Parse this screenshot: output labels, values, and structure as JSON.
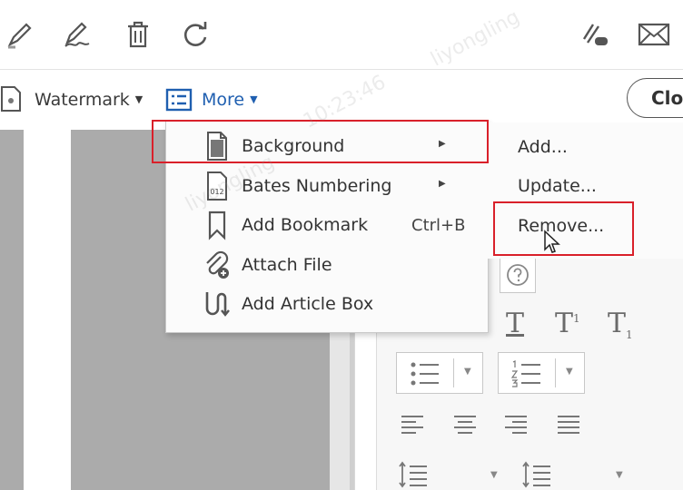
{
  "secondary_toolbar": {
    "watermark_label": "Watermark",
    "more_label": "More",
    "close_label": "Clo"
  },
  "more_menu": {
    "items": [
      {
        "label": "Background",
        "icon": "page-icon",
        "has_submenu": true,
        "highlighted": true
      },
      {
        "label": "Bates Numbering",
        "icon": "bates-number-icon",
        "has_submenu": true
      },
      {
        "label": "Add Bookmark",
        "icon": "bookmark-icon",
        "shortcut": "Ctrl+B"
      },
      {
        "label": "Attach File",
        "icon": "attach-file-icon"
      },
      {
        "label": "Add Article Box",
        "icon": "article-box-icon"
      }
    ]
  },
  "background_submenu": {
    "items": [
      {
        "label": "Add..."
      },
      {
        "label": "Update..."
      },
      {
        "label": "Remove...",
        "highlighted": true
      }
    ]
  },
  "bates_icon_text": "012",
  "overlay_watermark": {
    "name": "liyongling",
    "time": "10:23:46"
  },
  "colors": {
    "accent_blue": "#1f5fb0",
    "highlight_red": "#d9202a",
    "doc_gray": "#ababab"
  }
}
